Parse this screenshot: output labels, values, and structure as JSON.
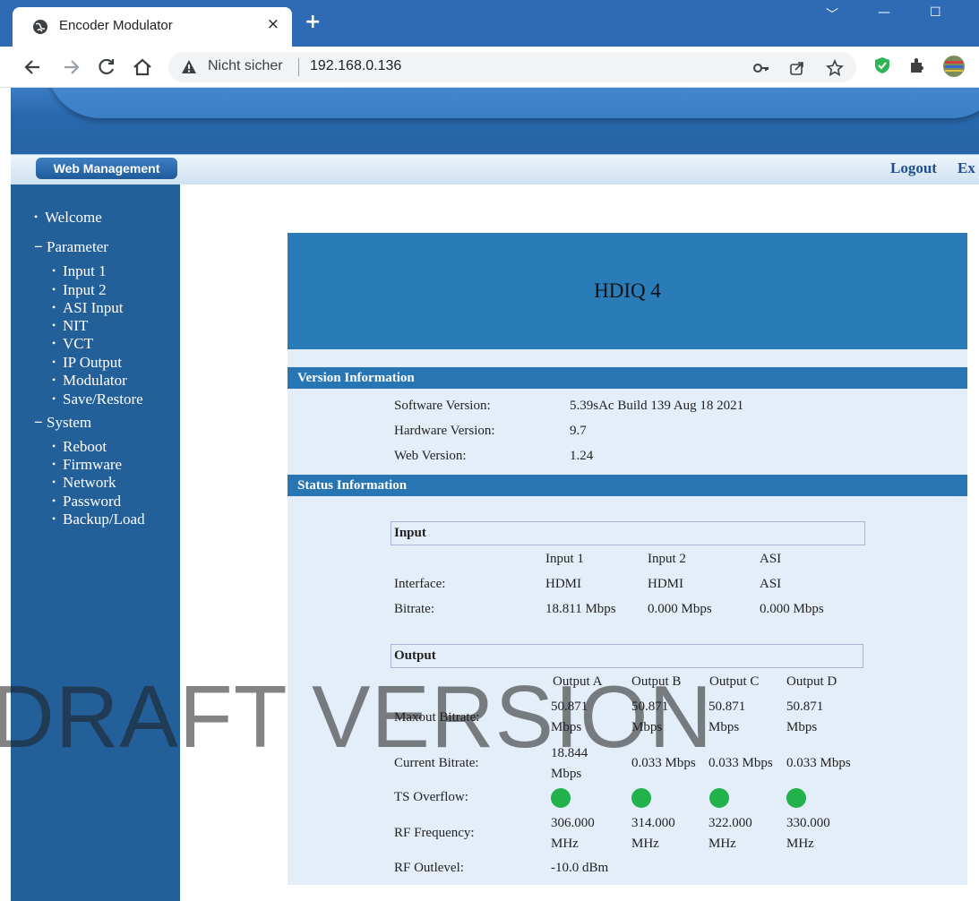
{
  "browser": {
    "tab_title": "Encoder Modulator",
    "tab_close": "×",
    "new_tab": "+",
    "security_label": "Nicht sicher",
    "url": "192.168.0.136",
    "window_controls": [
      "﹀",
      "—",
      "☐"
    ]
  },
  "header": {
    "management_label": "Web Management",
    "logout": "Logout",
    "exit_partial": "Ex"
  },
  "sidebar": {
    "welcome": "Welcome",
    "parameter": "Parameter",
    "parameter_items": [
      "Input 1",
      "Input 2",
      "ASI Input",
      "NIT",
      "VCT",
      "IP Output",
      "Modulator",
      "Save/Restore"
    ],
    "system": "System",
    "system_items": [
      "Reboot",
      "Firmware",
      "Network",
      "Password",
      "Backup/Load"
    ]
  },
  "device": {
    "title": "HDIQ 4"
  },
  "version": {
    "heading": "Version Information",
    "rows": [
      {
        "label": "Software Version:",
        "value": "5.39sAc Build 139 Aug 18 2021"
      },
      {
        "label": "Hardware Version:",
        "value": "9.7"
      },
      {
        "label": "Web Version:",
        "value": "1.24"
      }
    ]
  },
  "status": {
    "heading": "Status Information",
    "input": {
      "title": "Input",
      "columns": [
        "Input 1",
        "Input 2",
        "ASI"
      ],
      "interface_label": "Interface:",
      "interface": [
        "HDMI",
        "HDMI",
        "ASI"
      ],
      "bitrate_label": "Bitrate:",
      "bitrate": [
        "18.811 Mbps",
        "0.000 Mbps",
        "0.000 Mbps"
      ]
    },
    "output": {
      "title": "Output",
      "columns": [
        "Output A",
        "Output B",
        "Output C",
        "Output D"
      ],
      "maxout_label": "Maxout Bitrate:",
      "maxout": [
        "50.871 Mbps",
        "50.871 Mbps",
        "50.871 Mbps",
        "50.871 Mbps"
      ],
      "current_label": "Current Bitrate:",
      "current": [
        "18.844 Mbps",
        "0.033 Mbps",
        "0.033 Mbps",
        "0.033 Mbps"
      ],
      "ts_overflow_label": "TS Overflow:",
      "ts_overflow_status": [
        "ok",
        "ok",
        "ok",
        "ok"
      ],
      "status_color": "#22b24c",
      "rf_freq_label": "RF Frequency:",
      "rf_freq": [
        "306.000 MHz",
        "314.000 MHz",
        "322.000 MHz",
        "330.000 MHz"
      ],
      "rf_outlevel_label": "RF Outlevel:",
      "rf_outlevel": "-10.0 dBm"
    }
  },
  "watermark": "DRAFT VERSION"
}
